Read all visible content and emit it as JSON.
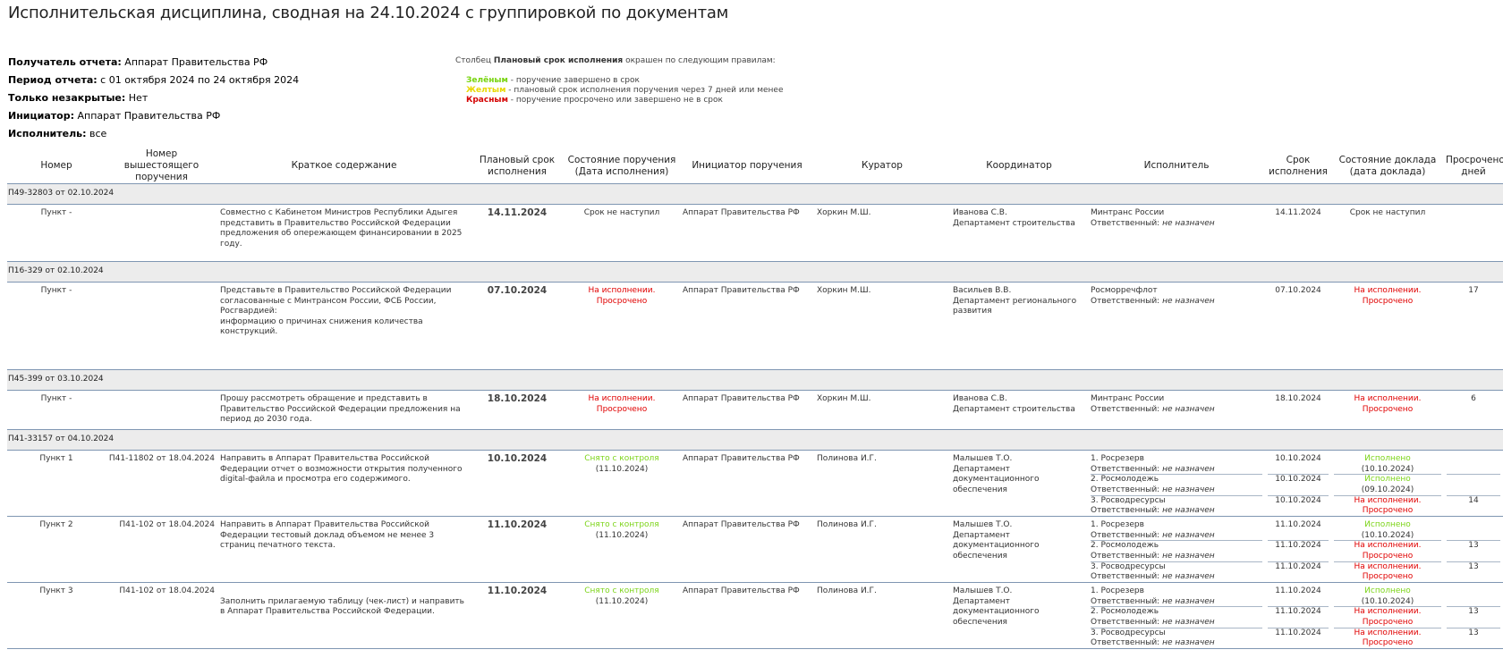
{
  "title": "Исполнительская дисциплина, сводная на 24.10.2024 с группировкой по документам",
  "params": [
    {
      "label": "Получатель отчета:",
      "value": " Аппарат Правительства РФ"
    },
    {
      "label": "Период отчета:",
      "value": " с 01 октября 2024 по 24 октября 2024"
    },
    {
      "label": "Только незакрытые:",
      "value": " Нет"
    },
    {
      "label": "Инициатор:",
      "value": " Аппарат Правительства РФ"
    },
    {
      "label": "Исполнитель:",
      "value": " все"
    }
  ],
  "legend": {
    "prefix": "Столбец ",
    "column": "Плановый срок исполнения",
    "suffix": " окрашен по следующим правилам:",
    "green_word": "Зелёным",
    "green_text": " - поручение завершено в срок",
    "yellow_word": "Желтым",
    "yellow_text": " - плановый срок исполнения поручения через 7 дней или менее",
    "red_word": "Красным",
    "red_text": " - поручение просрочено или завершено не в срок",
    "colors": {
      "green": "#78d40e",
      "yellow": "#e8d800",
      "red": "#d40000"
    }
  },
  "columns": [
    "Номер",
    "Номер вышестоящего поручения",
    "Краткое содержание",
    "Плановый срок исполнения",
    "Состояние поручения (Дата исполнения)",
    "Инициатор поручения",
    "Куратор",
    "Координатор",
    "Исполнитель",
    "Срок исполнения",
    "Состояние доклада (дата доклада)",
    "Просрочено дней"
  ],
  "responsible_label": "Ответственный: ",
  "not_assigned": "не назначен",
  "groups": [
    {
      "doc": "П49-32803 от 02.10.2024",
      "items": [
        {
          "num": "Пункт -",
          "parent": "",
          "content": "Совместно с Кабинетом Министров Республики Адыгея представить в Правительство Российской Федерации предложения об опережающем финансировании в 2025 году.",
          "plan": "14.11.2024",
          "state": "Срок не наступил",
          "state_date": "",
          "state_color": "normal",
          "initiator": "Аппарат Правительства РФ",
          "curator": "Хоркин М.Ш.",
          "coordinator": "Иванова С.В.",
          "coord_dept": "Департамент строительства",
          "execs": [
            {
              "name": "Минтранс России",
              "deadline": "14.11.2024",
              "report": "Срок не наступил",
              "report_date": "",
              "report_color": "normal",
              "overdue": ""
            }
          ]
        }
      ]
    },
    {
      "doc": "П16-329 от 02.10.2024",
      "items": [
        {
          "num": "Пункт -",
          "parent": "",
          "content": "Представьте в Правительство Российской Федерации согласованные с Минтрансом России, ФСБ России, Росгвардией:\nинформацию о причинах снижения количества конструкций.",
          "plan": "07.10.2024",
          "state": "На исполнении. Просрочено",
          "state_date": "",
          "state_color": "red",
          "initiator": "Аппарат Правительства РФ",
          "curator": "Хоркин М.Ш.",
          "coordinator": "Васильев В.В.",
          "coord_dept": "Департамент регионального развития",
          "execs": [
            {
              "name": "Росморречфлот",
              "deadline": "07.10.2024",
              "report": "На исполнении. Просрочено",
              "report_date": "",
              "report_color": "red",
              "overdue": "17"
            }
          ]
        }
      ]
    },
    {
      "doc": "П45-399 от 03.10.2024",
      "items": [
        {
          "num": "Пункт -",
          "parent": "",
          "content": "Прошу рассмотреть обращение и представить в Правительство Российской Федерации предложения на период до 2030 года.",
          "plan": "18.10.2024",
          "state": "На исполнении. Просрочено",
          "state_date": "",
          "state_color": "red",
          "initiator": "Аппарат Правительства РФ",
          "curator": "Хоркин М.Ш.",
          "coordinator": "Иванова С.В.",
          "coord_dept": "Департамент строительства",
          "execs": [
            {
              "name": "Минтранс России",
              "deadline": "18.10.2024",
              "report": "На исполнении. Просрочено",
              "report_date": "",
              "report_color": "red",
              "overdue": "6"
            }
          ]
        }
      ]
    },
    {
      "doc": "П41-33157 от 04.10.2024",
      "items": [
        {
          "num": "Пункт 1",
          "parent": "П41-11802 от 18.04.2024",
          "content": "Направить в Аппарат Правительства Российской Федерации отчет о возможности открытия полученного digital-файла и просмотра его содержимого.",
          "plan": "10.10.2024",
          "state": "Снято с контроля",
          "state_date": "(11.10.2024)",
          "state_color": "green",
          "initiator": "Аппарат Правительства РФ",
          "curator": "Полинова И.Г.",
          "coordinator": "Малышев Т.О.",
          "coord_dept": "Департамент документационного обеспечения",
          "execs": [
            {
              "name": "1. Росрезерв",
              "deadline": "10.10.2024",
              "report": "Исполнено",
              "report_date": "(10.10.2024)",
              "report_color": "green",
              "overdue": ""
            },
            {
              "name": "2. Росмолодежь",
              "deadline": "10.10.2024",
              "report": "Исполнено",
              "report_date": "(09.10.2024)",
              "report_color": "green",
              "overdue": ""
            },
            {
              "name": "3. Росводресурсы",
              "deadline": "10.10.2024",
              "report": "На исполнении. Просрочено",
              "report_date": "",
              "report_color": "red",
              "overdue": "14"
            }
          ]
        },
        {
          "num": "Пункт 2",
          "parent": "П41-102 от 18.04.2024",
          "content": "Направить в Аппарат Правительства Российской Федерации тестовый доклад объемом не менее 3 страниц печатного текста.",
          "plan": "11.10.2024",
          "state": "Снято с контроля",
          "state_date": "(11.10.2024)",
          "state_color": "green",
          "initiator": "Аппарат Правительства РФ",
          "curator": "Полинова И.Г.",
          "coordinator": "Малышев Т.О.",
          "coord_dept": "Департамент документационного обеспечения",
          "execs": [
            {
              "name": "1. Росрезерв",
              "deadline": "11.10.2024",
              "report": "Исполнено",
              "report_date": "(10.10.2024)",
              "report_color": "green",
              "overdue": ""
            },
            {
              "name": "2. Росмолодежь",
              "deadline": "11.10.2024",
              "report": "На исполнении. Просрочено",
              "report_date": "",
              "report_color": "red",
              "overdue": "13"
            },
            {
              "name": "3. Росводресурсы",
              "deadline": "11.10.2024",
              "report": "На исполнении. Просрочено",
              "report_date": "",
              "report_color": "red",
              "overdue": "13"
            }
          ]
        },
        {
          "num": "Пункт 3",
          "parent": "П41-102 от 18.04.2024",
          "content": "\nЗаполнить прилагаемую таблицу (чек-лист) и направить в Аппарат Правительства Российской Федерации.",
          "plan": "11.10.2024",
          "state": "Снято с контроля",
          "state_date": "(11.10.2024)",
          "state_color": "green",
          "initiator": "Аппарат Правительства РФ",
          "curator": "Полинова И.Г.",
          "coordinator": "Малышев Т.О.",
          "coord_dept": "Департамент документационного обеспечения",
          "execs": [
            {
              "name": "1. Росрезерв",
              "deadline": "11.10.2024",
              "report": "Исполнено",
              "report_date": "(10.10.2024)",
              "report_color": "green",
              "overdue": ""
            },
            {
              "name": "2. Росмолодежь",
              "deadline": "11.10.2024",
              "report": "На исполнении. Просрочено",
              "report_date": "",
              "report_color": "red",
              "overdue": "13"
            },
            {
              "name": "3. Росводресурсы",
              "deadline": "11.10.2024",
              "report": "На исполнении. Просрочено",
              "report_date": "",
              "report_color": "red",
              "overdue": "13"
            }
          ]
        }
      ]
    }
  ]
}
